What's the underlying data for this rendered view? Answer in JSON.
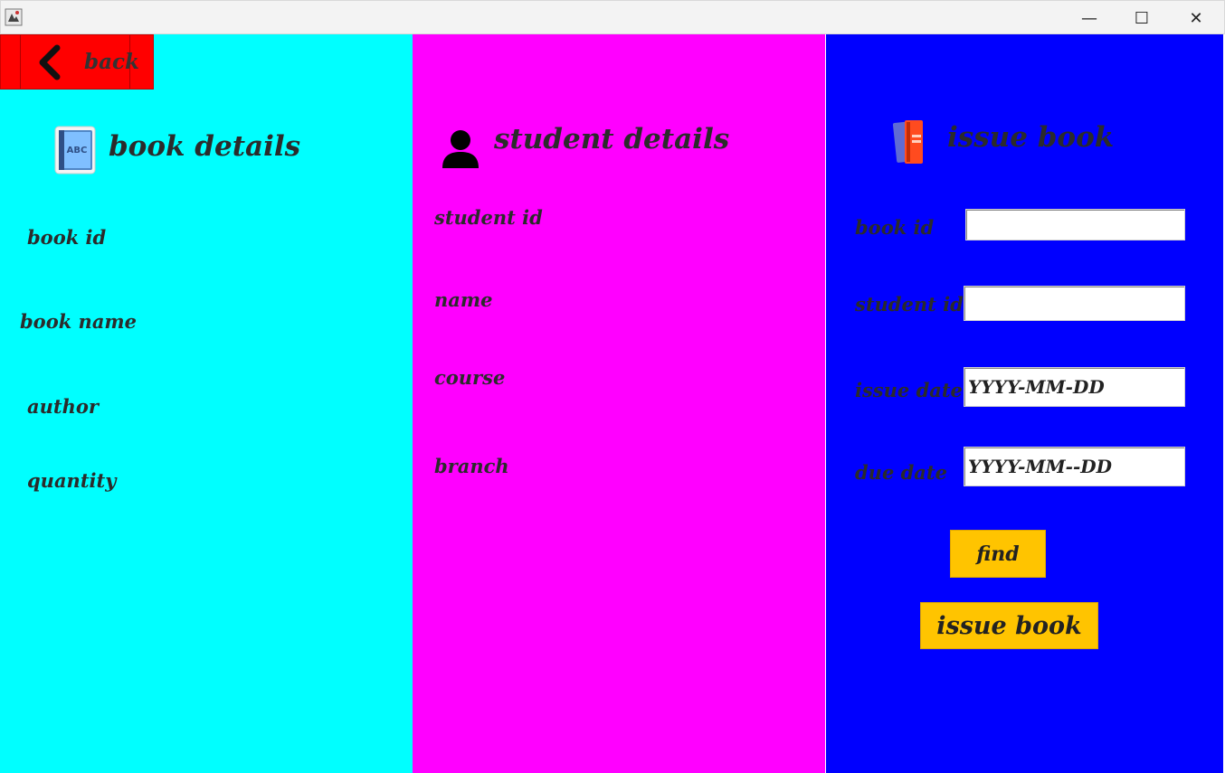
{
  "window": {
    "minimize_glyph": "—",
    "maximize_glyph": "☐",
    "close_glyph": "✕"
  },
  "back_button": {
    "label": "back",
    "icon": "chevron-left-icon"
  },
  "book_panel": {
    "heading": "book details",
    "icon": "book-abc-icon",
    "icon_text": "ABC",
    "labels": {
      "book_id": "book id",
      "book_name": "book name",
      "author": "author",
      "quantity": "quantity"
    },
    "background": "#00ffff"
  },
  "student_panel": {
    "heading": "student details",
    "icon": "user-icon",
    "labels": {
      "student_id": "student id",
      "name": "name",
      "course": "course",
      "branch": "branch"
    },
    "background": "#ff00ff"
  },
  "issue_panel": {
    "heading": "issue book",
    "icon": "books-icon",
    "labels": {
      "book_id": "book id",
      "student_id": "student id",
      "issue_date": "issue date",
      "due_date": "due date"
    },
    "fields": {
      "book_id_value": "",
      "student_id_value": "",
      "issue_date_value": "YYYY-MM-DD",
      "due_date_value": "YYYY-MM--DD"
    },
    "buttons": {
      "find": "find",
      "issue_book": "issue book"
    },
    "background": "#0000ff",
    "button_color": "#ffc400"
  }
}
